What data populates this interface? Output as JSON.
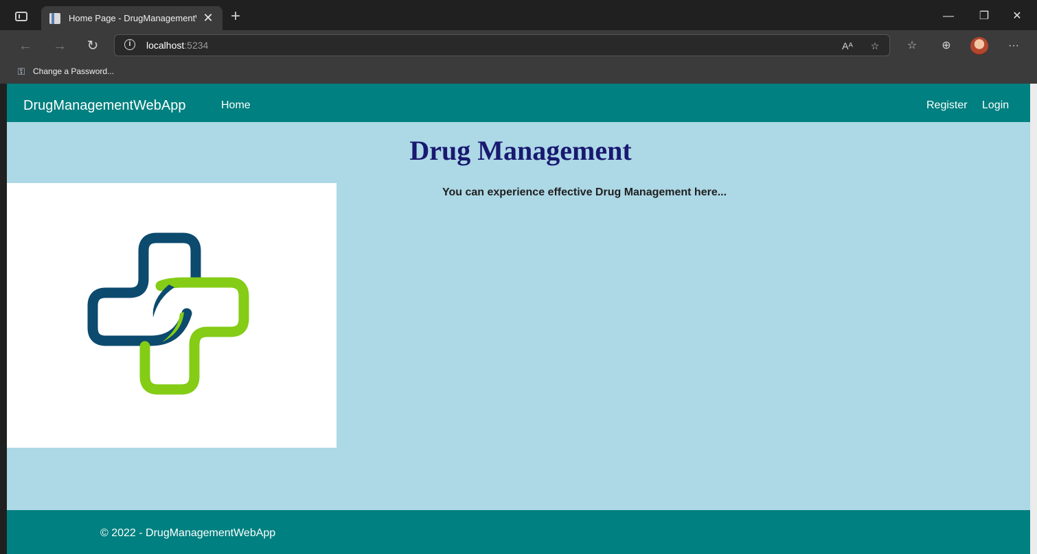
{
  "browser": {
    "tab_title": "Home Page - DrugManagementWebApp",
    "tab_close": "✕",
    "new_tab": "+",
    "window": {
      "minimize": "—",
      "restore": "❐",
      "close": "✕"
    },
    "url_host": "localhost",
    "url_port": ":5234",
    "bookmark_label": "Change a Password...",
    "toolbar_icons": [
      "read-aloud-icon",
      "favorite-add-icon",
      "favorites-icon",
      "collections-icon",
      "profile-avatar",
      "more-icon"
    ]
  },
  "site": {
    "brand": "DrugManagementWebApp",
    "nav_home": "Home",
    "nav_register": "Register",
    "nav_login": "Login",
    "headline": "Drug Management",
    "tagline": "You can experience effective Drug Management here...",
    "footer": "© 2022 - DrugManagementWebApp"
  },
  "colors": {
    "navbar": "#008080",
    "page_background": "#add8e6",
    "headline": "#191970",
    "logo_blue": "#0c4a6e",
    "logo_green": "#84cc16"
  }
}
